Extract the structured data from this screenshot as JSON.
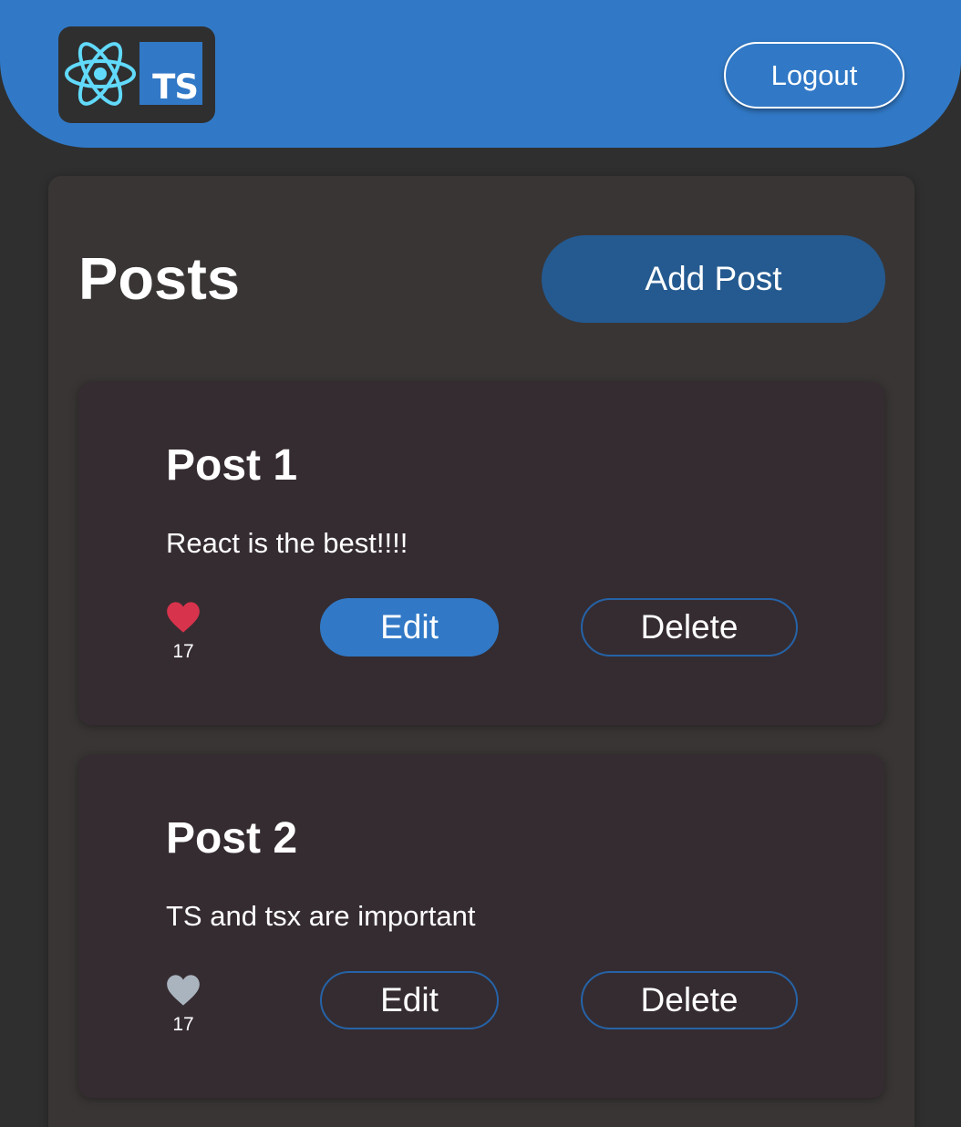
{
  "header": {
    "logo_text": "TS",
    "logout_label": "Logout"
  },
  "main": {
    "title": "Posts",
    "add_post_label": "Add Post"
  },
  "posts": [
    {
      "title": "Post 1",
      "body": "React is the best!!!!",
      "likes": "17",
      "liked": true,
      "edit_label": "Edit",
      "delete_label": "Delete"
    },
    {
      "title": "Post 2",
      "body": "TS and tsx are important",
      "likes": "17",
      "liked": false,
      "edit_label": "Edit",
      "delete_label": "Delete"
    }
  ],
  "colors": {
    "brand_blue": "#3179c6",
    "like_active": "#d8334c",
    "like_inactive": "#aab4bf"
  }
}
